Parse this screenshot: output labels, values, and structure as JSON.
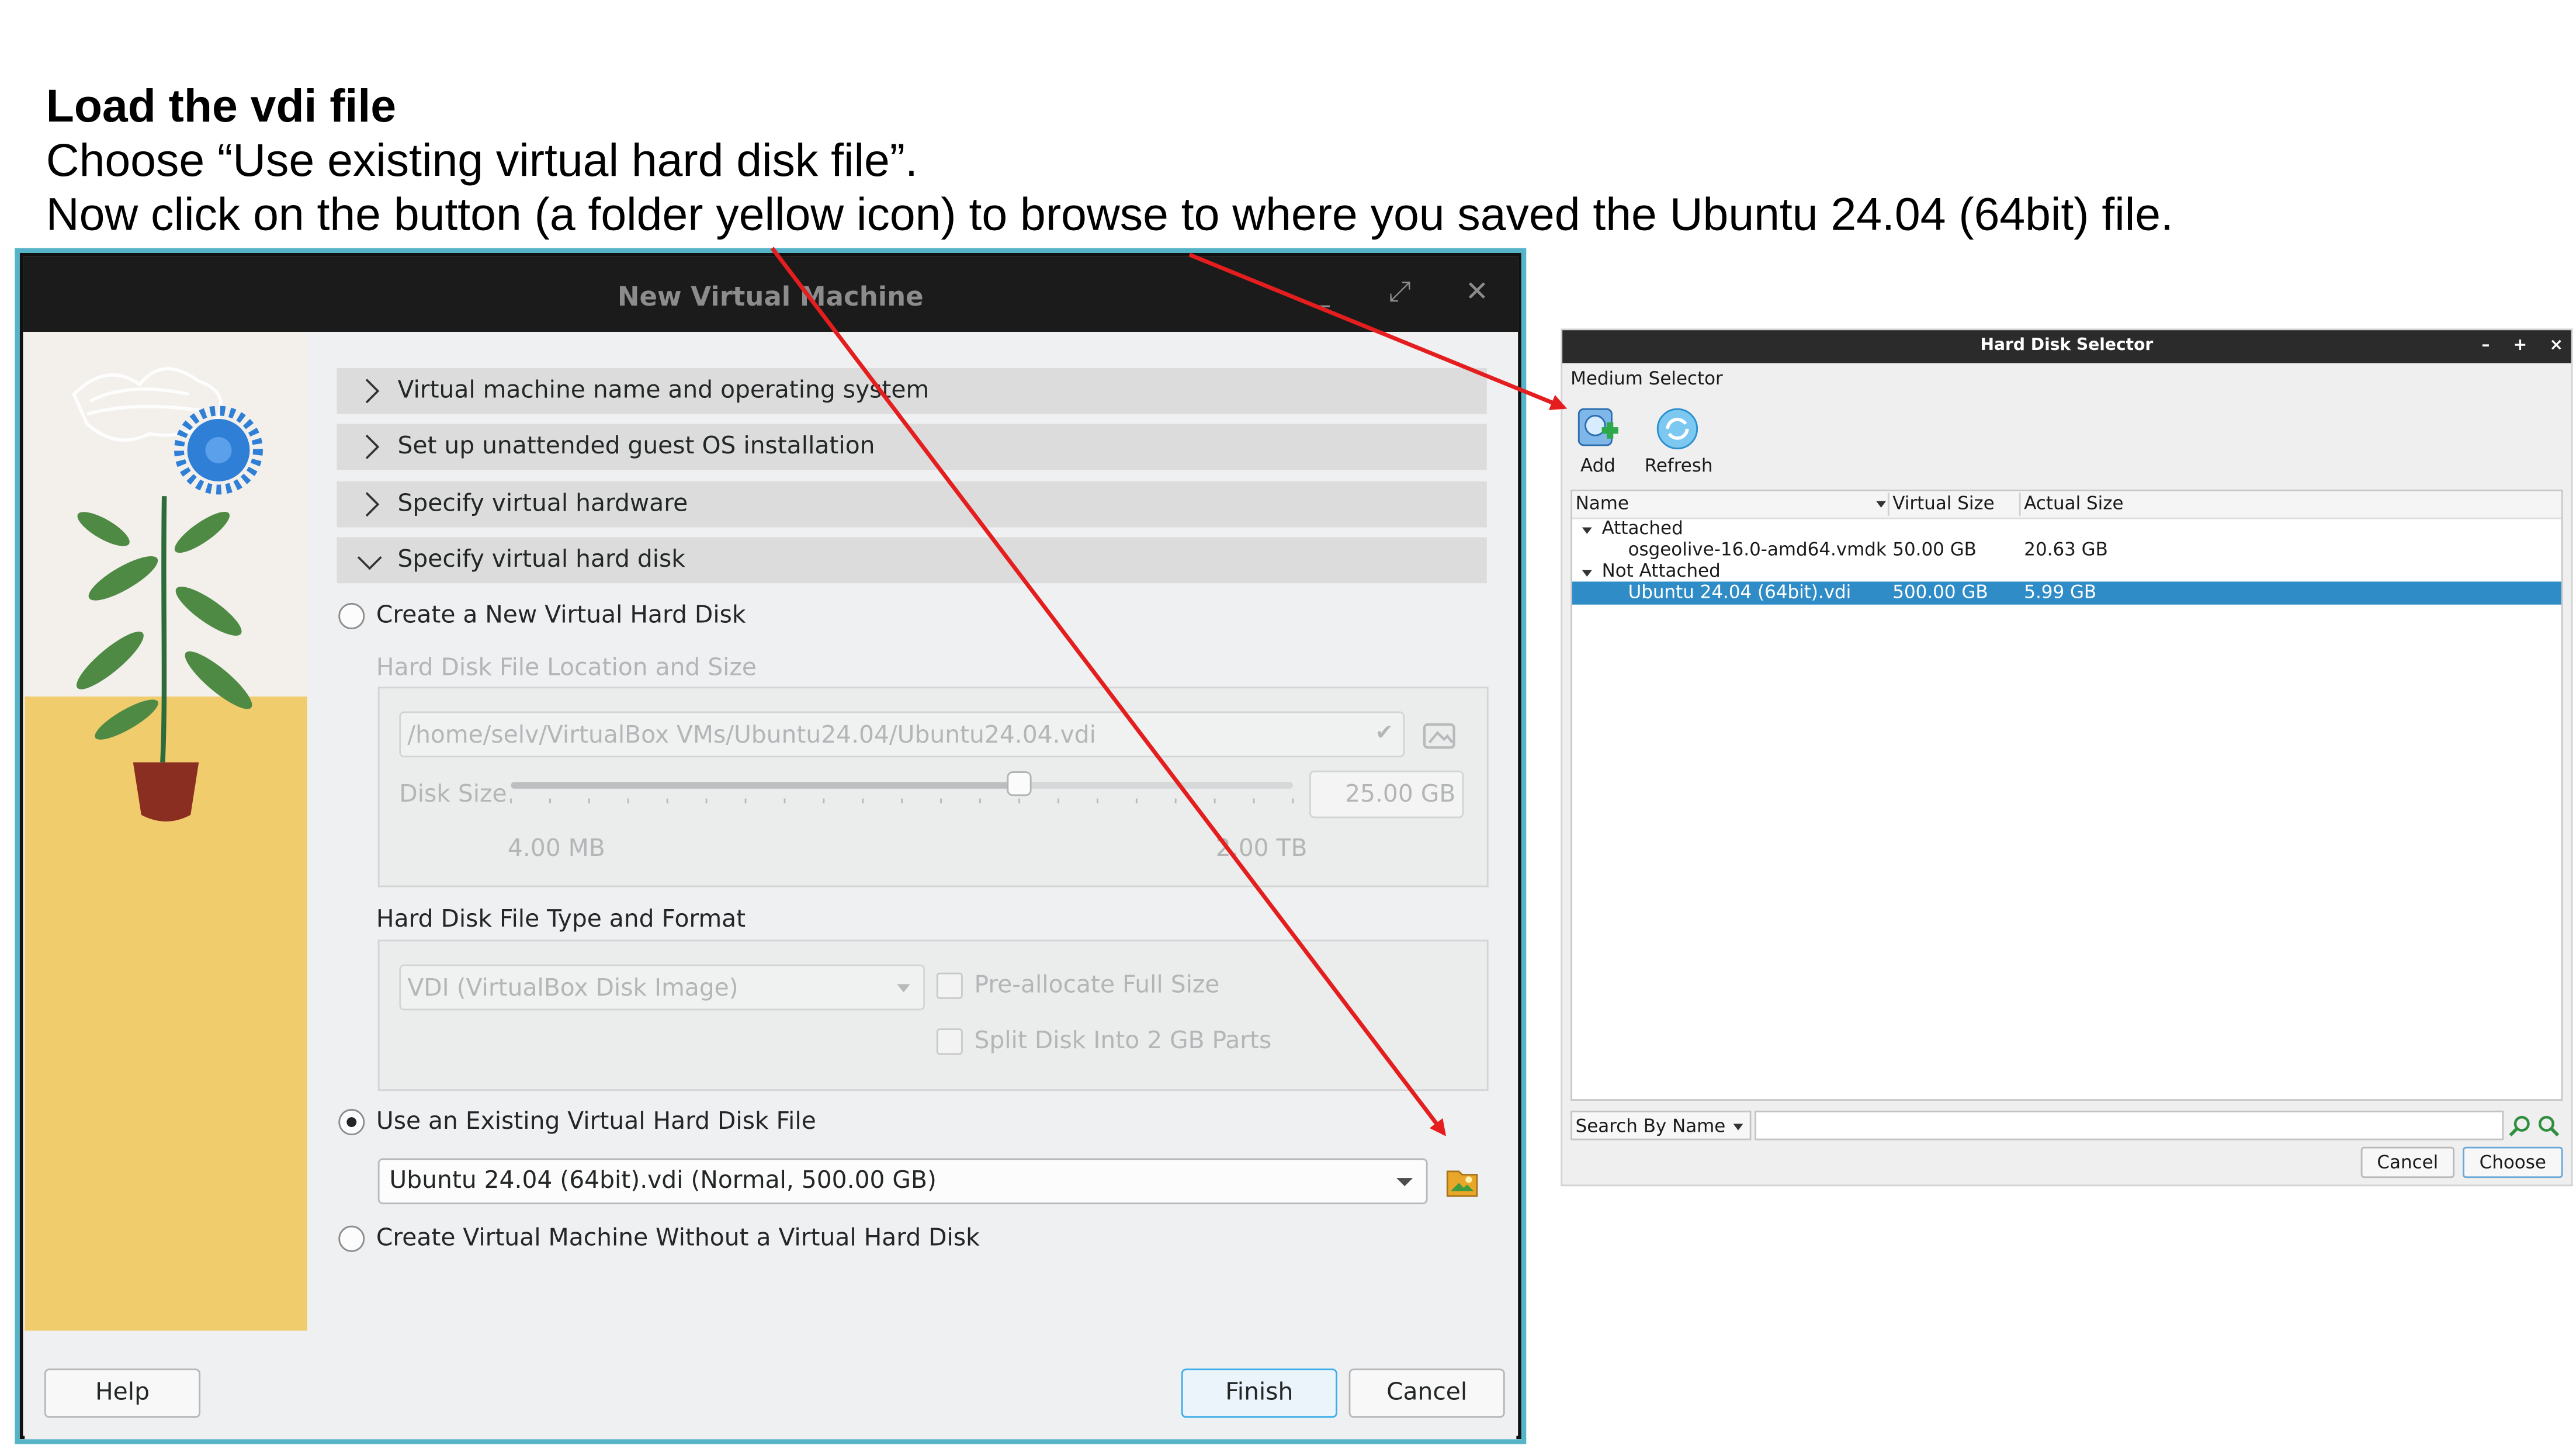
{
  "instructions": {
    "heading": "Load the vdi file",
    "line1": "Choose “Use existing virtual hard disk file”.",
    "line2": "Now click on the button (a folder yellow icon) to browse to where you saved the Ubuntu 24.04 (64bit) file."
  },
  "new_vm": {
    "title": "New Virtual Machine",
    "sections": [
      "Virtual machine name and operating system",
      "Set up unattended guest OS installation",
      "Specify virtual hardware",
      "Specify virtual hard disk"
    ],
    "opt_create": "Create a New Virtual Hard Disk",
    "location_group": "Hard Disk File Location and Size",
    "location_path": "/home/selv/VirtualBox VMs/Ubuntu24.04/Ubuntu24.04.vdi",
    "disk_size_label": "Disk Size",
    "disk_size_value": "25.00 GB",
    "disk_size_level": 0.65,
    "slider_min": "4.00 MB",
    "slider_max": "2.00 TB",
    "type_group": "Hard Disk File Type and Format",
    "type_value": "VDI (VirtualBox Disk Image)",
    "preallocate": "Pre-allocate Full Size",
    "split": "Split Disk Into 2 GB Parts",
    "opt_existing": "Use an Existing Virtual Hard Disk File",
    "existing_value": "Ubuntu 24.04 (64bit).vdi (Normal, 500.00 GB)",
    "opt_none": "Create Virtual Machine Without a Virtual Hard Disk",
    "buttons": {
      "help": "Help",
      "finish": "Finish",
      "cancel": "Cancel"
    }
  },
  "hds": {
    "title": "Hard Disk Selector",
    "menu": "Medium Selector",
    "tool_add": "Add",
    "tool_refresh": "Refresh",
    "columns": [
      "Name",
      "Virtual Size",
      "Actual Size"
    ],
    "groups": [
      {
        "label": "Attached",
        "rows": [
          {
            "name": "osgeolive-16.0-amd64.vmdk",
            "virtual": "50.00 GB",
            "actual": "20.63 GB"
          }
        ]
      },
      {
        "label": "Not Attached",
        "rows": [
          {
            "name": "Ubuntu 24.04 (64bit).vdi",
            "virtual": "500.00 GB",
            "actual": "5.99 GB"
          }
        ]
      }
    ],
    "search_mode": "Search By Name",
    "buttons": {
      "cancel": "Cancel",
      "choose": "Choose"
    }
  },
  "colors": {
    "accent": "#3daee9",
    "window_border": "#55b4c7",
    "selection": "#308cc6",
    "arrow": "#e41e1e",
    "folder": "#e9a72a"
  }
}
